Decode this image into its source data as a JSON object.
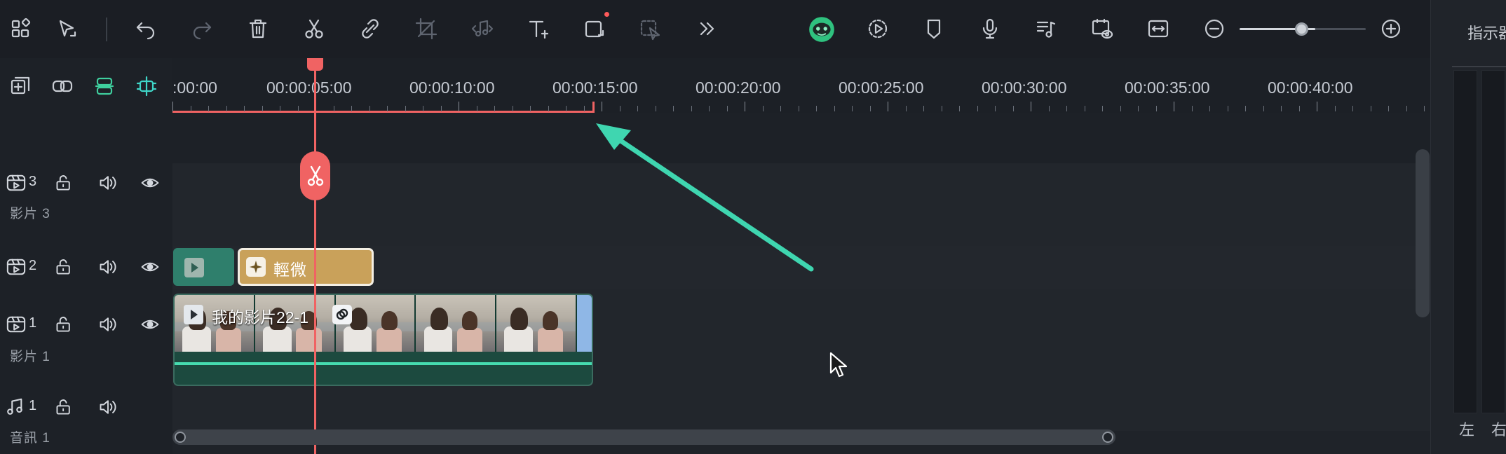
{
  "toolbar": {
    "icons": [
      "layout-icon",
      "select-arrow-icon",
      "undo-icon",
      "redo-icon",
      "delete-icon",
      "cut-icon",
      "unlink-icon",
      "crop-icon",
      "audio-icon",
      "text-icon",
      "shape-icon",
      "mask-icon",
      "more-icon",
      "ai-mascot-icon",
      "render-icon",
      "marker-icon",
      "mic-icon",
      "music-list-icon",
      "preview-icon",
      "fit-icon",
      "zoom-out-icon",
      "zoom-in-icon"
    ],
    "zoom_level": 0.6
  },
  "right_panel": {
    "title": "指示器",
    "left_label": "左",
    "right_label": "右"
  },
  "left_tools": [
    "add-track-icon",
    "link-icon",
    "magnetic-icon",
    "snap-icon"
  ],
  "tracks": [
    {
      "id": "video-3",
      "number": "3",
      "name": "影片 3"
    },
    {
      "id": "video-2",
      "number": "2",
      "name": ""
    },
    {
      "id": "video-1",
      "number": "1",
      "name": "影片 1"
    },
    {
      "id": "audio-1",
      "number": "1",
      "name": "音訊 1"
    }
  ],
  "ruler": {
    "labels": [
      ":00:00",
      "00:00:05:00",
      "00:00:10:00",
      "00:00:15:00",
      "00:00:20:00",
      "00:00:25:00",
      "00:00:30:00",
      "00:00:35:00",
      "00:00:40:00"
    ]
  },
  "clips": {
    "effect_label": "輕微",
    "video_title": "我的影片22-1"
  },
  "colors": {
    "playhead": "#f06363",
    "clip_gold": "#c9a15a",
    "audio_wave": "#46dcb0",
    "annotation_arrow": "#3fd6b0"
  }
}
